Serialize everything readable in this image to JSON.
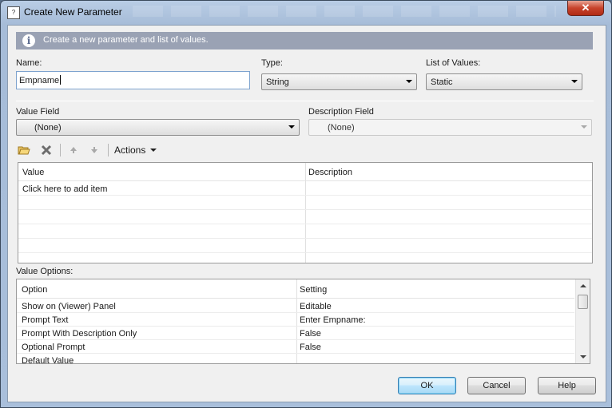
{
  "window": {
    "title": "Create New Parameter",
    "close_label": "✕"
  },
  "info": {
    "text": "Create a new parameter and list of values.",
    "icon": "info-icon"
  },
  "fields": {
    "name_label": "Name:",
    "name_value": "Empname",
    "type_label": "Type:",
    "type_value": "String",
    "list_label": "List of Values:",
    "list_value": "Static",
    "value_field_label": "Value Field",
    "value_field_value": "(None)",
    "description_field_label": "Description Field",
    "description_field_value": "(None)"
  },
  "toolbar": {
    "actions_label": "Actions",
    "icons": [
      "folder-open-icon",
      "delete-icon",
      "move-up-icon",
      "move-down-icon"
    ]
  },
  "values_grid": {
    "columns": [
      "Value",
      "Description"
    ],
    "rows": [
      [
        "Click here to add item",
        ""
      ],
      [
        "",
        ""
      ],
      [
        "",
        ""
      ],
      [
        "",
        ""
      ],
      [
        "",
        ""
      ],
      [
        "",
        ""
      ]
    ]
  },
  "value_options": {
    "label": "Value Options:",
    "columns": [
      "Option",
      "Setting"
    ],
    "rows": [
      [
        "Show on (Viewer) Panel",
        "Editable"
      ],
      [
        "Prompt Text",
        "Enter Empname:"
      ],
      [
        "Prompt With Description Only",
        "False"
      ],
      [
        "Optional Prompt",
        "False"
      ],
      [
        "Default Value",
        ""
      ]
    ]
  },
  "buttons": {
    "ok": "OK",
    "cancel": "Cancel",
    "help": "Help"
  },
  "colors": {
    "info_bar": "#9aa2b4",
    "title_gradient": "#b9cde5",
    "close_button": "#c7432c"
  }
}
